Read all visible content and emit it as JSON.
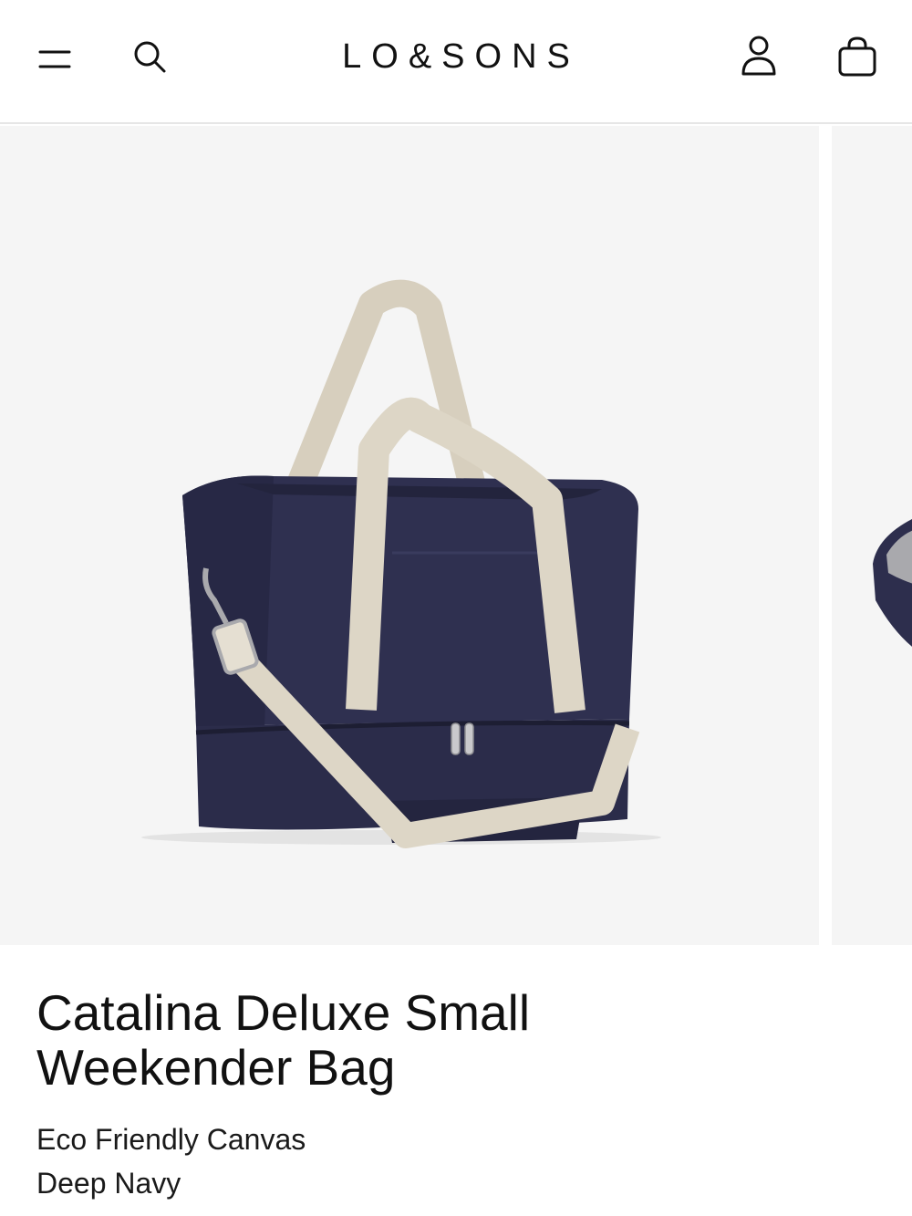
{
  "header": {
    "logo_text": "LO&SONS",
    "icons": {
      "menu": "menu-icon",
      "search": "search-icon",
      "account": "account-icon",
      "cart": "shopping-bag-icon"
    }
  },
  "gallery": {
    "main_image_alt": "Catalina Deluxe Small Weekender Bag in Deep Navy",
    "colors": {
      "background": "#f5f5f5",
      "bag_body": "#2e2f4f",
      "strap": "#ddd6c6"
    }
  },
  "product": {
    "title": "Catalina Deluxe Small Weekender Bag",
    "material": "Eco Friendly Canvas",
    "color": "Deep Navy"
  }
}
